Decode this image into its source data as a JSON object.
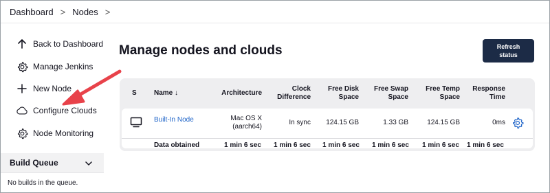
{
  "breadcrumb": {
    "items": [
      "Dashboard",
      "Nodes"
    ],
    "separator": ">"
  },
  "sidebar": {
    "items": [
      {
        "label": "Back to Dashboard",
        "icon": "arrow-up-icon"
      },
      {
        "label": "Manage Jenkins",
        "icon": "gear-icon"
      },
      {
        "label": "New Node",
        "icon": "plus-icon"
      },
      {
        "label": "Configure Clouds",
        "icon": "cloud-icon"
      },
      {
        "label": "Node Monitoring",
        "icon": "gear-icon"
      }
    ]
  },
  "build_queue": {
    "title": "Build Queue",
    "empty_text": "No builds in the queue."
  },
  "main": {
    "title": "Manage nodes and clouds",
    "refresh_button": "Refresh status"
  },
  "table": {
    "headers": {
      "s": "S",
      "name": "Name ↓",
      "architecture": "Architecture",
      "clock_difference": "Clock Difference",
      "free_disk_space": "Free Disk Space",
      "free_swap_space": "Free Swap Space",
      "free_temp_space": "Free Temp Space",
      "response_time": "Response Time"
    },
    "rows": [
      {
        "icon": "computer-icon",
        "name": "Built-In Node",
        "architecture": "Mac OS X (aarch64)",
        "clock_difference": "In sync",
        "free_disk_space": "124.15 GB",
        "free_swap_space": "1.33 GB",
        "free_temp_space": "124.15 GB",
        "response_time": "0ms",
        "action_icon": "gear-icon"
      }
    ],
    "summary": {
      "label": "Data obtained",
      "architecture": "1 min 6 sec",
      "clock_difference": "1 min 6 sec",
      "free_disk_space": "1 min 6 sec",
      "free_swap_space": "1 min 6 sec",
      "free_temp_space": "1 min 6 sec",
      "response_time": "1 min 6 sec"
    }
  },
  "colors": {
    "accent": "#1c2b46",
    "link": "#1f64c8",
    "annotation": "#e8424a"
  }
}
